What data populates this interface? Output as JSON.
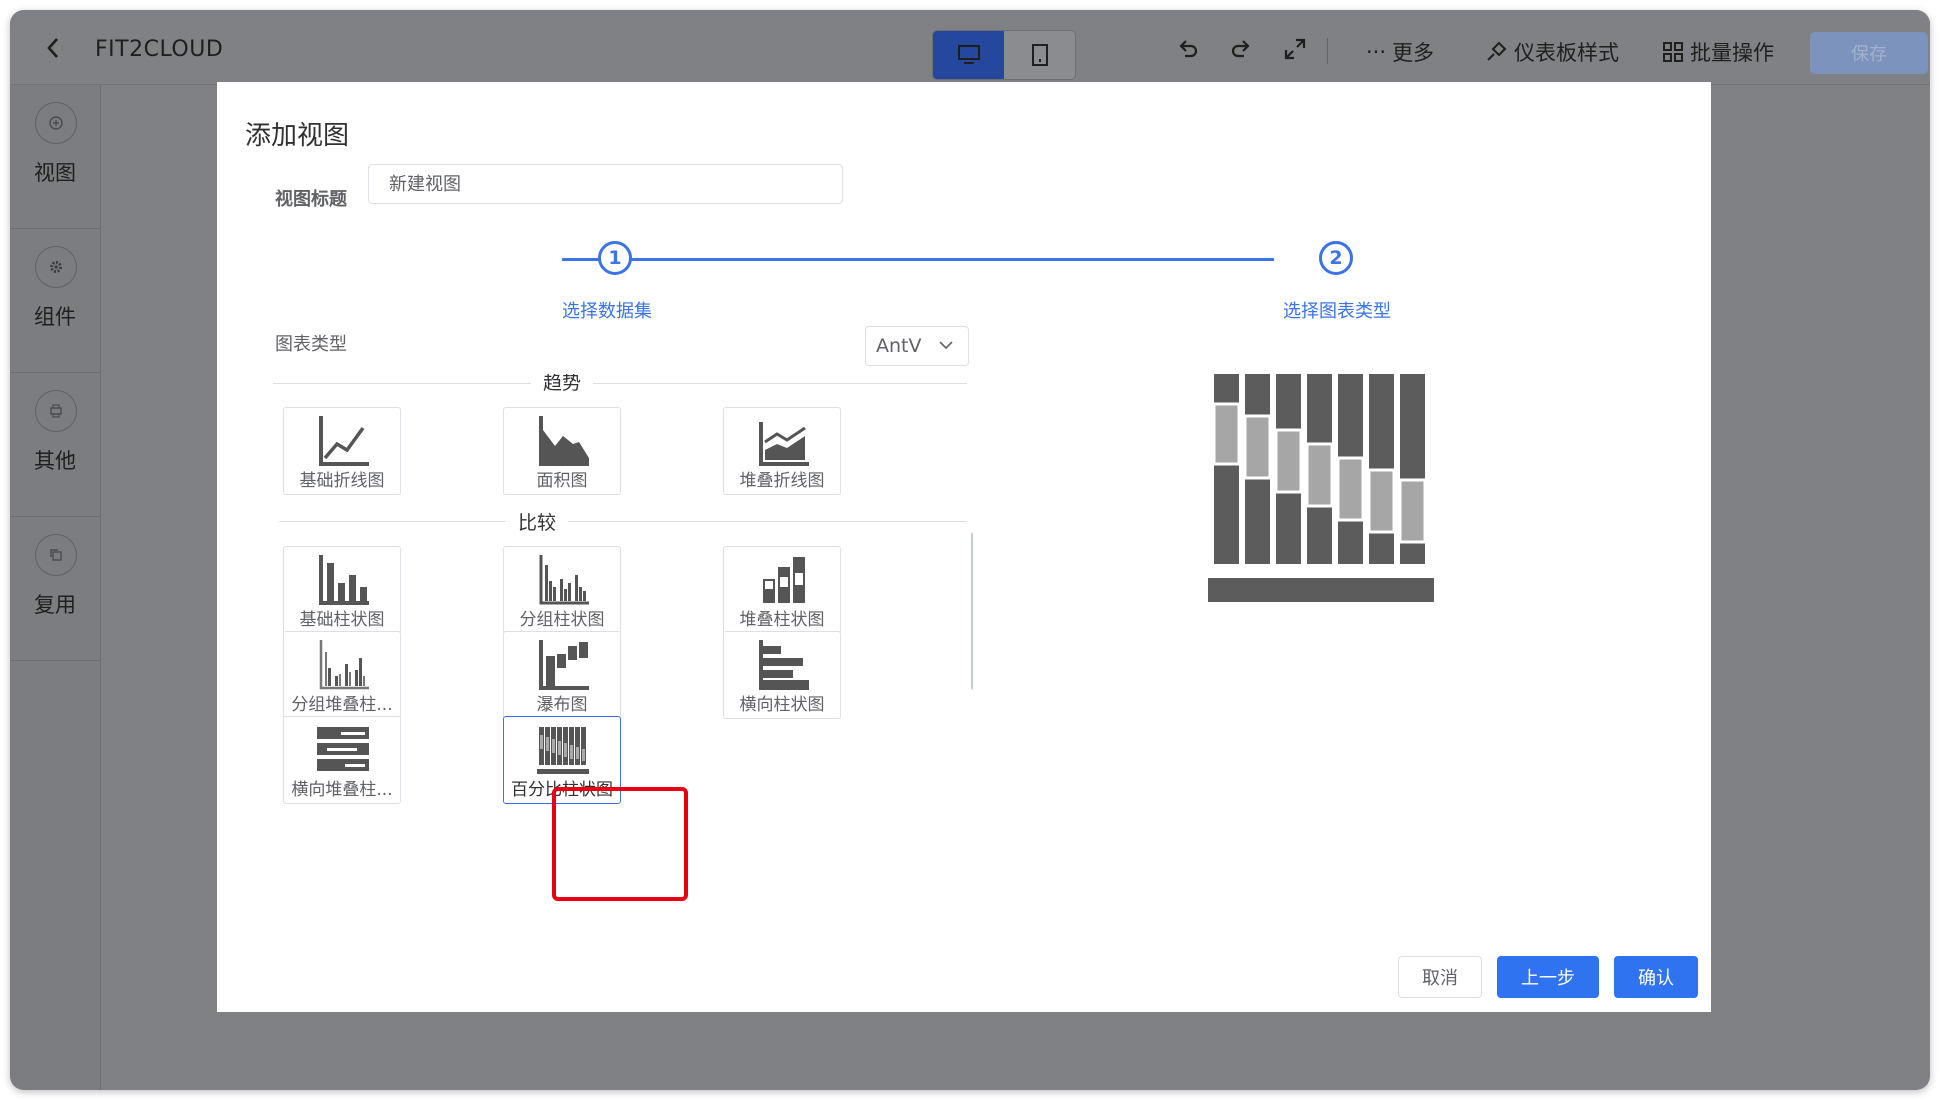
{
  "app": {
    "title": "FIT2CLOUD",
    "accent_color": "#2f73f0",
    "highlight_color": "#e60012"
  },
  "topbar": {
    "device_toggle": [
      {
        "icon": "desktop-icon",
        "active": true
      },
      {
        "icon": "tablet-icon",
        "active": false
      }
    ],
    "tools": [
      "undo-icon",
      "redo-icon",
      "fullscreen-icon"
    ],
    "more_label": "更多",
    "dashboard_style_label": "仪表板样式",
    "batch_label": "批量操作",
    "save_label": "保存"
  },
  "sidebar": {
    "items": [
      {
        "label": "视图",
        "icon": "add-icon"
      },
      {
        "label": "组件",
        "icon": "gear-icon"
      },
      {
        "label": "其他",
        "icon": "print-icon"
      },
      {
        "label": "复用",
        "icon": "copy-icon"
      }
    ]
  },
  "dialog": {
    "title": "添加视图",
    "view_title_label": "视图标题",
    "view_title_value": "新建视图",
    "steps": [
      {
        "number": "1",
        "label": "选择数据集"
      },
      {
        "number": "2",
        "label": "选择图表类型"
      }
    ],
    "chart_type_label": "图表类型",
    "engine": "AntV",
    "groups": [
      {
        "title": "趋势",
        "charts": [
          {
            "label": "基础折线图",
            "icon": "line-chart-icon"
          },
          {
            "label": "面积图",
            "icon": "area-chart-icon"
          },
          {
            "label": "堆叠折线图",
            "icon": "stacked-line-chart-icon"
          }
        ]
      },
      {
        "title": "比较",
        "charts": [
          {
            "label": "基础柱状图",
            "icon": "bar-chart-icon"
          },
          {
            "label": "分组柱状图",
            "icon": "grouped-bar-chart-icon"
          },
          {
            "label": "堆叠柱状图",
            "icon": "stacked-bar-chart-icon"
          },
          {
            "label": "分组堆叠柱...",
            "icon": "grouped-stacked-bar-chart-icon"
          },
          {
            "label": "瀑布图",
            "icon": "waterfall-chart-icon"
          },
          {
            "label": "横向柱状图",
            "icon": "horizontal-bar-chart-icon"
          },
          {
            "label": "横向堆叠柱...",
            "icon": "horizontal-stacked-bar-chart-icon"
          },
          {
            "label": "百分比柱状图",
            "icon": "percent-bar-chart-icon",
            "selected": true
          }
        ]
      }
    ],
    "cancel_label": "取消",
    "prev_label": "上一步",
    "confirm_label": "确认"
  }
}
